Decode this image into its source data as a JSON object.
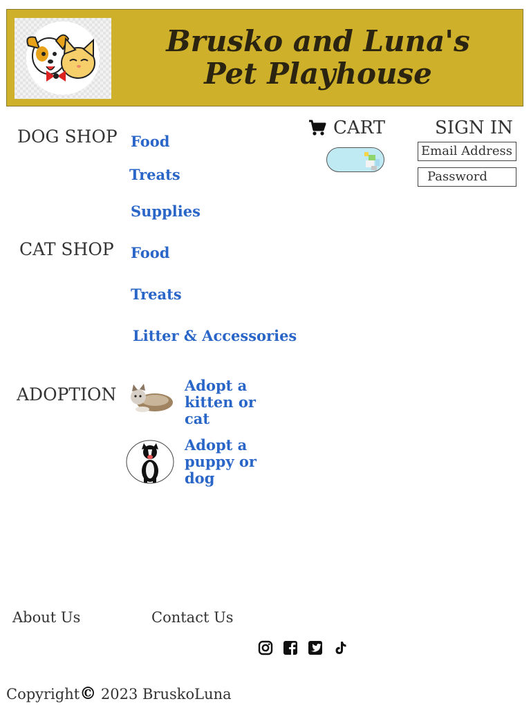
{
  "header": {
    "title": "Brusko and Luna's Pet Playhouse",
    "logo_icon": "dog-and-cat-logo-icon"
  },
  "dog_shop": {
    "title": "DOG SHOP",
    "links": [
      "Food",
      "Treats",
      "Supplies"
    ]
  },
  "cat_shop": {
    "title": "CAT SHOP",
    "links": [
      "Food",
      "Treats",
      "Litter & Accessories"
    ]
  },
  "adoption": {
    "title": "ADOPTION",
    "items": [
      {
        "label": "Adopt a kitten or cat",
        "lines": [
          "Adopt a",
          "kitten or",
          "cat"
        ],
        "icon": "cat-photo"
      },
      {
        "label": "Adopt a puppy or dog",
        "lines": [
          "Adopt a",
          "puppy or",
          "dog"
        ],
        "icon": "dog-photo"
      }
    ]
  },
  "cart": {
    "label": "CART",
    "icon": "shopping-cart-icon"
  },
  "signin": {
    "title": "SIGN IN",
    "email_placeholder": "Email Address",
    "password_placeholder": "Password"
  },
  "footer": {
    "about": "About Us",
    "contact": "Contact Us",
    "social_icons": [
      "instagram-icon",
      "facebook-icon",
      "twitter-icon",
      "tiktok-icon"
    ],
    "copyright_prefix": "Copyright",
    "copyright_symbol": "©",
    "copyright_suffix": " 2023 BruskoLuna"
  },
  "colors": {
    "header_bg": "#cfb02a",
    "link": "#2a66c8",
    "text": "#333333"
  }
}
